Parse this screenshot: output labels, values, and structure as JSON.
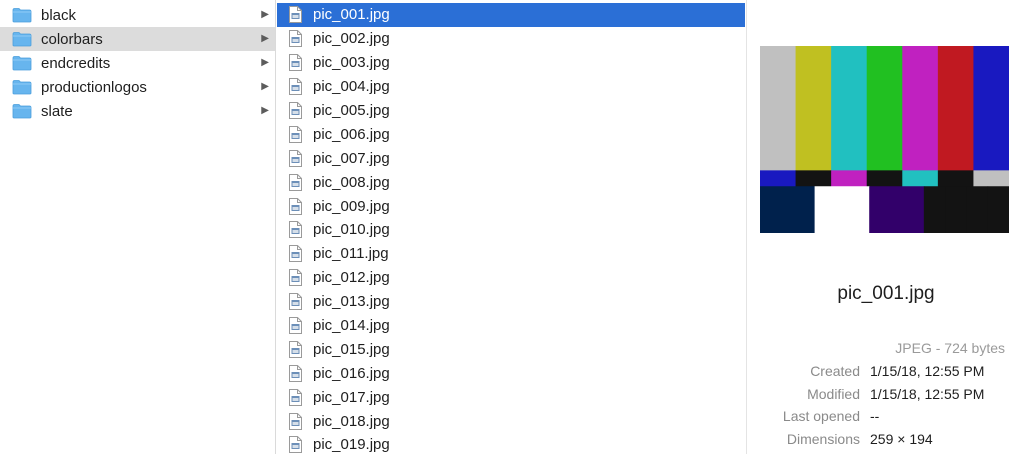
{
  "folders": [
    {
      "label": "black",
      "selected": false
    },
    {
      "label": "colorbars",
      "selected": true
    },
    {
      "label": "endcredits",
      "selected": false
    },
    {
      "label": "productionlogos",
      "selected": false
    },
    {
      "label": "slate",
      "selected": false
    }
  ],
  "files": [
    {
      "label": "pic_001.jpg",
      "selected": true
    },
    {
      "label": "pic_002.jpg"
    },
    {
      "label": "pic_003.jpg"
    },
    {
      "label": "pic_004.jpg"
    },
    {
      "label": "pic_005.jpg"
    },
    {
      "label": "pic_006.jpg"
    },
    {
      "label": "pic_007.jpg"
    },
    {
      "label": "pic_008.jpg"
    },
    {
      "label": "pic_009.jpg"
    },
    {
      "label": "pic_010.jpg"
    },
    {
      "label": "pic_011.jpg"
    },
    {
      "label": "pic_012.jpg"
    },
    {
      "label": "pic_013.jpg"
    },
    {
      "label": "pic_014.jpg"
    },
    {
      "label": "pic_015.jpg"
    },
    {
      "label": "pic_016.jpg"
    },
    {
      "label": "pic_017.jpg"
    },
    {
      "label": "pic_018.jpg"
    },
    {
      "label": "pic_019.jpg"
    }
  ],
  "preview": {
    "name": "pic_001.jpg",
    "kind_size": "JPEG - 724 bytes",
    "info": [
      {
        "label": "Created",
        "value": "1/15/18, 12:55 PM"
      },
      {
        "label": "Modified",
        "value": "1/15/18, 12:55 PM"
      },
      {
        "label": "Last opened",
        "value": "--"
      },
      {
        "label": "Dimensions",
        "value": "259 × 194"
      }
    ],
    "colorbars": {
      "top": [
        "#c0c0c0",
        "#c0c021",
        "#21c0c0",
        "#21c021",
        "#c021c0",
        "#c01921",
        "#1919c0"
      ],
      "middle": [
        "#1919c0",
        "#131313",
        "#c021c0",
        "#131313",
        "#21c0c0",
        "#131313",
        "#c0c0c0"
      ],
      "bottom": [
        "#00214c",
        "#ffffff",
        "#32006a",
        "#131313",
        "#131313",
        "#131313",
        "#131313"
      ]
    }
  },
  "colors": {
    "selection": "#2b6fd6",
    "folder_fill": "#67b5ee",
    "inactive_selection": "#dcdcdc"
  }
}
